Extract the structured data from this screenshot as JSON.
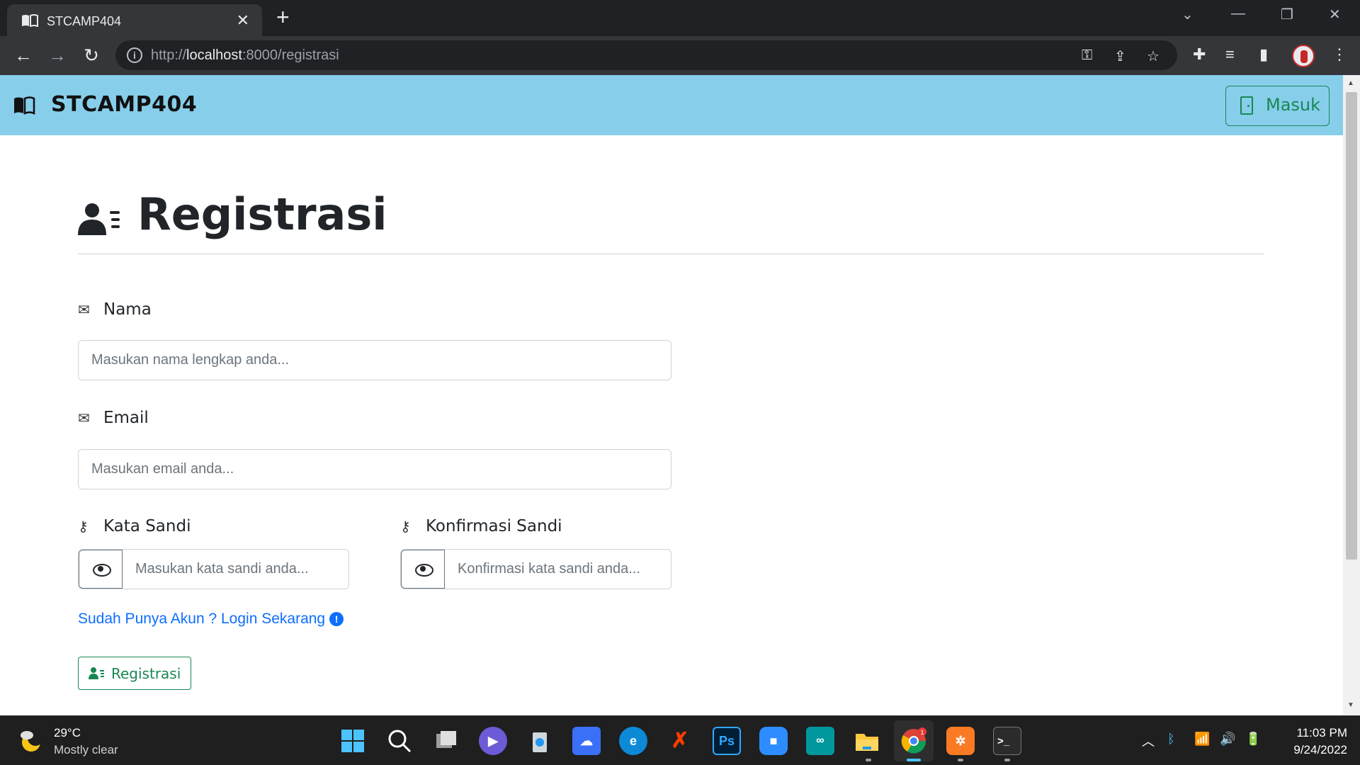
{
  "browser": {
    "tab_title": "STCAMP404",
    "tab_close": "✕",
    "new_tab": "+",
    "url_scheme": "http://",
    "url_host": "localhost",
    "url_rest": ":8000/registrasi"
  },
  "site": {
    "brand": "STCAMP404",
    "login_button": "Masuk"
  },
  "page": {
    "title": "Registrasi",
    "fields": {
      "name_label": "Nama",
      "name_placeholder": "Masukan nama lengkap anda...",
      "email_label": "Email",
      "email_placeholder": "Masukan email anda...",
      "password_label": "Kata Sandi",
      "password_placeholder": "Masukan kata sandi anda...",
      "confirm_label": "Konfirmasi Sandi",
      "confirm_placeholder": "Konfirmasi kata sandi anda..."
    },
    "login_link": "Sudah Punya Akun ? Login Sekarang",
    "submit_button": "Registrasi"
  },
  "taskbar": {
    "weather_temp": "29°C",
    "weather_desc": "Mostly clear",
    "time": "11:03 PM",
    "date": "9/24/2022",
    "chrome_badge": "1"
  },
  "colors": {
    "navbar_bg": "#87ceeb",
    "success": "#198754",
    "link": "#0d6efd"
  }
}
